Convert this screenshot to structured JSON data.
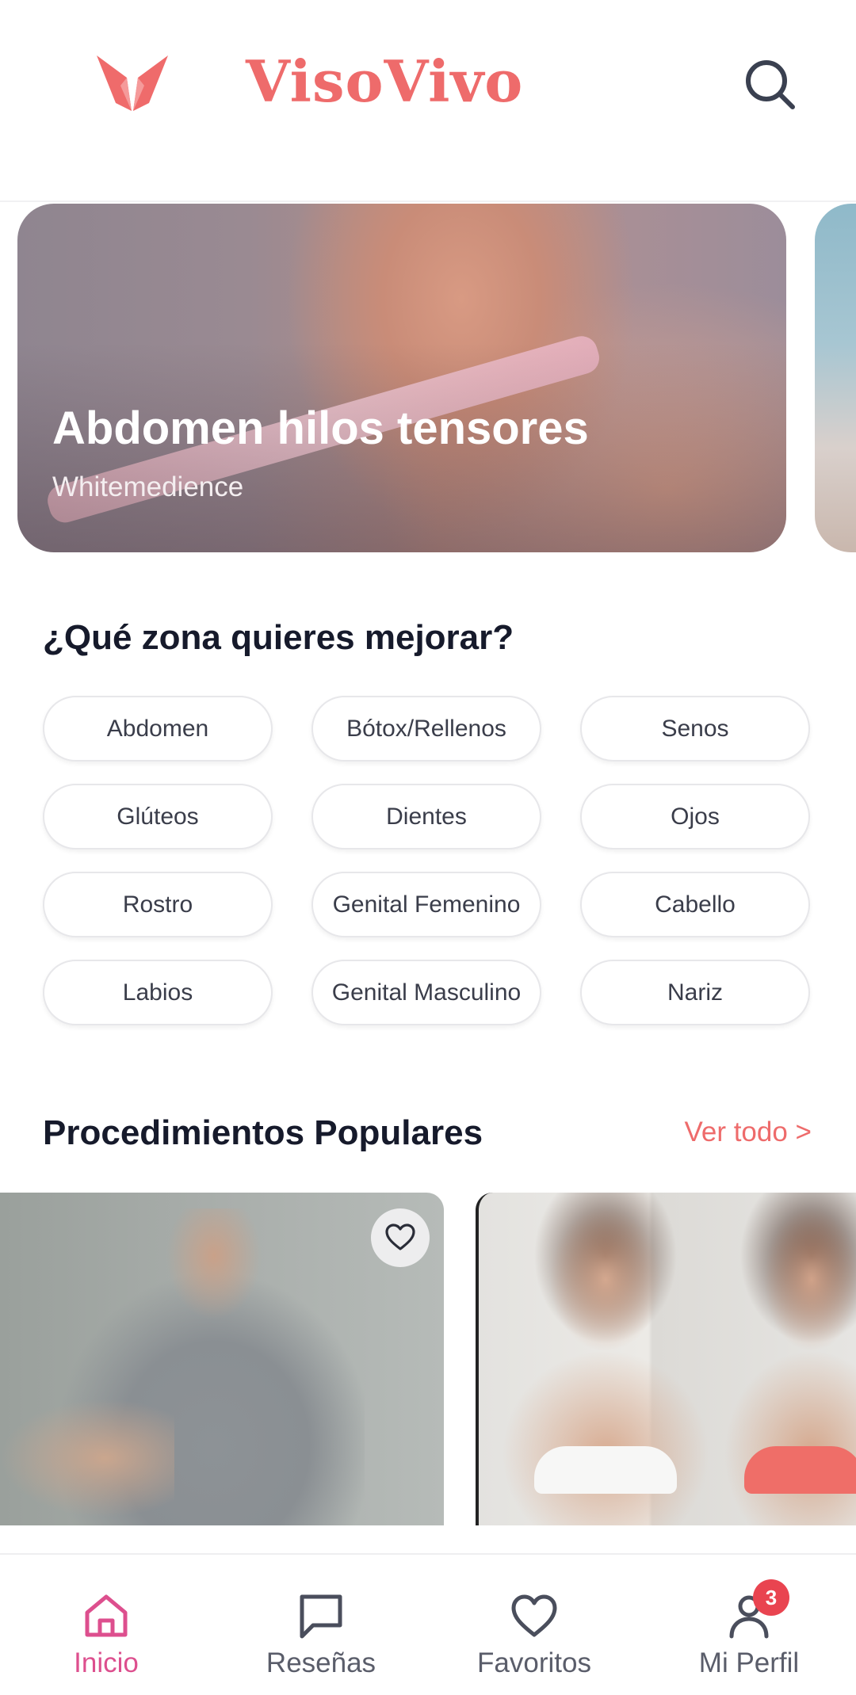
{
  "header": {
    "brand": "VisoVivo",
    "logo_icon": "butterfly-logo",
    "search_icon": "search-icon",
    "accent_color": "#ee6b6b"
  },
  "banner": {
    "title": "Abdomen hilos tensores",
    "subtitle": "Whitemedience"
  },
  "zones": {
    "title": "¿Qué zona quieres mejorar?",
    "items": [
      "Abdomen",
      "Bótox/Rellenos",
      "Senos",
      "Glúteos",
      "Dientes",
      "Ojos",
      "Rostro",
      "Genital Femenino",
      "Cabello",
      "Labios",
      "Genital Masculino",
      "Nariz"
    ]
  },
  "popular": {
    "title": "Procedimientos Populares",
    "see_all": "Ver todo >",
    "favorite_icon": "heart-icon"
  },
  "bottom_nav": {
    "items": [
      {
        "label": "Inicio",
        "icon": "home-icon",
        "active": true
      },
      {
        "label": "Reseñas",
        "icon": "chat-bubble-icon",
        "active": false
      },
      {
        "label": "Favoritos",
        "icon": "heart-icon",
        "active": false
      },
      {
        "label": "Mi Perfil",
        "icon": "user-icon",
        "active": false
      }
    ],
    "profile_badge": "3",
    "active_color": "#dd4f8e",
    "badge_color": "#e94450"
  }
}
